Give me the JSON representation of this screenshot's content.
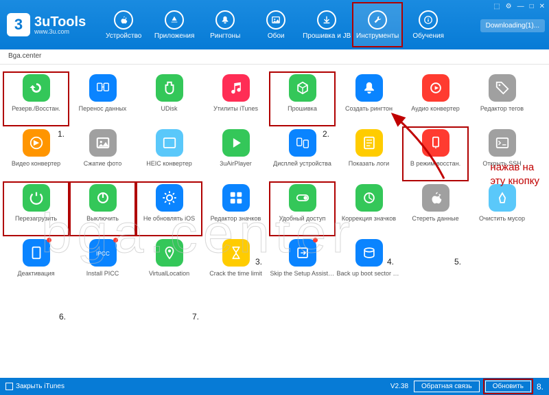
{
  "logo": {
    "num": "3",
    "name": "3uTools",
    "url": "www.3u.com"
  },
  "winControls": {
    "fs": "⬚",
    "gear": "⚙",
    "min": "—",
    "max": "□",
    "close": "✕"
  },
  "downloadBtn": "Downloading(1)...",
  "nav": [
    {
      "id": "device",
      "label": "Устройство",
      "icon": "apple"
    },
    {
      "id": "apps",
      "label": "Приложения",
      "icon": "appstore"
    },
    {
      "id": "ringtones",
      "label": "Рингтоны",
      "icon": "bell"
    },
    {
      "id": "wallpapers",
      "label": "Обои",
      "icon": "photo"
    },
    {
      "id": "flash",
      "label": "Прошивка и JB",
      "icon": "down"
    },
    {
      "id": "tools",
      "label": "Инструменты",
      "icon": "wrench",
      "active": true
    },
    {
      "id": "tutorials",
      "label": "Обучения",
      "icon": "info"
    }
  ],
  "breadcrumb": "Bga.center",
  "watermark": "bga.center",
  "annotation": {
    "line1": "нажав на",
    "line2": "эту кнопку"
  },
  "numbers": [
    "1.",
    "2.",
    "3.",
    "4.",
    "5.",
    "6.",
    "7.",
    "8."
  ],
  "tools": [
    {
      "id": "backup",
      "label": "Резерв./Восстан.",
      "color": "#34c759",
      "icon": "restore",
      "hl": true
    },
    {
      "id": "migrate",
      "label": "Перенос данных",
      "color": "#0a84ff",
      "icon": "migrate"
    },
    {
      "id": "udisk",
      "label": "UDisk",
      "color": "#34c759",
      "icon": "usb"
    },
    {
      "id": "itunes-util",
      "label": "Утилиты iTunes",
      "color": "#ff2d55",
      "icon": "music"
    },
    {
      "id": "firmware",
      "label": "Прошивка",
      "color": "#34c759",
      "icon": "cube",
      "hl": true
    },
    {
      "id": "make-ringtone",
      "label": "Создать рингтон",
      "color": "#0a84ff",
      "icon": "bell"
    },
    {
      "id": "audio-conv",
      "label": "Аудио конвертер",
      "color": "#ff3b30",
      "icon": "audio"
    },
    {
      "id": "tag-editor",
      "label": "Редактор тегов",
      "color": "#a0a0a0",
      "icon": "tag"
    },
    {
      "id": "video-conv",
      "label": "Видео конвертер",
      "color": "#ff9500",
      "icon": "video"
    },
    {
      "id": "compress",
      "label": "Сжатие фото",
      "color": "#a0a0a0",
      "icon": "photo"
    },
    {
      "id": "heic",
      "label": "HEIC конвертер",
      "color": "#5ac8fa",
      "icon": "heic"
    },
    {
      "id": "airplayer",
      "label": "3uAirPlayer",
      "color": "#34c759",
      "icon": "play"
    },
    {
      "id": "screens",
      "label": "Дисплей устройства",
      "color": "#0a84ff",
      "icon": "screens"
    },
    {
      "id": "logs",
      "label": "Показать логи",
      "color": "#ffcc00",
      "icon": "logs"
    },
    {
      "id": "recovery",
      "label": "В режим восстан.",
      "color": "#ff3b30",
      "icon": "recovery",
      "hl": true
    },
    {
      "id": "ssh",
      "label": "Открыть SSH",
      "color": "#a0a0a0",
      "icon": "ssh"
    },
    {
      "id": "reboot",
      "label": "Перезагрузить",
      "color": "#34c759",
      "icon": "reboot",
      "hl": true
    },
    {
      "id": "shutdown",
      "label": "Выключить",
      "color": "#34c759",
      "icon": "power",
      "hl": true
    },
    {
      "id": "noupdate",
      "label": "Не обновлять iOS",
      "color": "#0a84ff",
      "icon": "gear",
      "hl": true
    },
    {
      "id": "iconedit",
      "label": "Редактор значков",
      "color": "#0a84ff",
      "icon": "iconedit"
    },
    {
      "id": "easyaccess",
      "label": "Удобный доступ",
      "color": "#34c759",
      "icon": "toggle",
      "hl": true
    },
    {
      "id": "iconfix",
      "label": "Коррекция значков",
      "color": "#34c759",
      "icon": "iconfix"
    },
    {
      "id": "erase",
      "label": "Стереть данные",
      "color": "#a0a0a0",
      "icon": "apple"
    },
    {
      "id": "clean",
      "label": "Очистить мусор",
      "color": "#5ac8fa",
      "icon": "clean"
    },
    {
      "id": "deactivate",
      "label": "Деактивация",
      "color": "#0a84ff",
      "icon": "tablet",
      "dot": true
    },
    {
      "id": "ipcc",
      "label": "Install PICC",
      "color": "#0a84ff",
      "icon": "ipcc",
      "dot": true
    },
    {
      "id": "vloc",
      "label": "VirtualLocation",
      "color": "#34c759",
      "icon": "pin"
    },
    {
      "id": "crack",
      "label": "Crack the time limit",
      "color": "#ffcc00",
      "icon": "hourglass"
    },
    {
      "id": "skipsetup",
      "label": "Skip the Setup Assistant",
      "color": "#0a84ff",
      "icon": "skip",
      "dot": true
    },
    {
      "id": "bootsector",
      "label": "Back up boot sector dat",
      "color": "#0a84ff",
      "icon": "disk"
    }
  ],
  "statusbar": {
    "closeItunes": "Закрыть iTunes",
    "version": "V2.38",
    "feedback": "Обратная связь",
    "update": "Обновить"
  }
}
